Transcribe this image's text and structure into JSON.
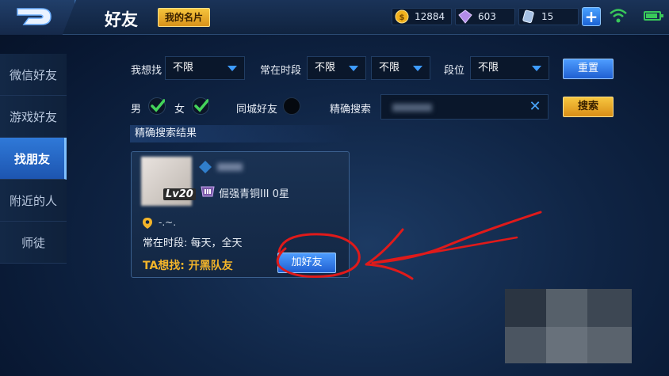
{
  "header": {
    "title": "好友",
    "my_card_label": "我的名片",
    "gold": "12884",
    "diamond": "603",
    "voucher": "15",
    "plus_label": "+"
  },
  "sidebar": {
    "items": [
      {
        "label": "微信好友"
      },
      {
        "label": "游戏好友"
      },
      {
        "label": "找朋友"
      },
      {
        "label": "附近的人"
      },
      {
        "label": "师徒"
      }
    ],
    "active_index": 2
  },
  "filters": {
    "want_label": "我想找",
    "want_value": "不限",
    "time_label": "常在时段",
    "time_value_1": "不限",
    "time_value_2": "不限",
    "rank_label": "段位",
    "rank_value": "不限",
    "reset_label": "重置",
    "male_label": "男",
    "female_label": "女",
    "male_checked": true,
    "female_checked": true,
    "same_city_label": "同城好友",
    "same_city_on": false,
    "exact_search_label": "精确搜索",
    "search_label": "搜索"
  },
  "results": {
    "section_title": "精确搜索结果",
    "card": {
      "level": "Lv20",
      "rank": "倔强青铜III 0星",
      "location": "-.~.",
      "active_time": "常在时段: 每天，全天",
      "want": "TA想找: 开黑队友",
      "add_friend_label": "加好友"
    }
  },
  "colors": {
    "accent_blue": "#2f79d8",
    "gold_button": "#f7c63f",
    "annotation_red": "#e01a1a",
    "highlight_text": "#f4b52a"
  }
}
